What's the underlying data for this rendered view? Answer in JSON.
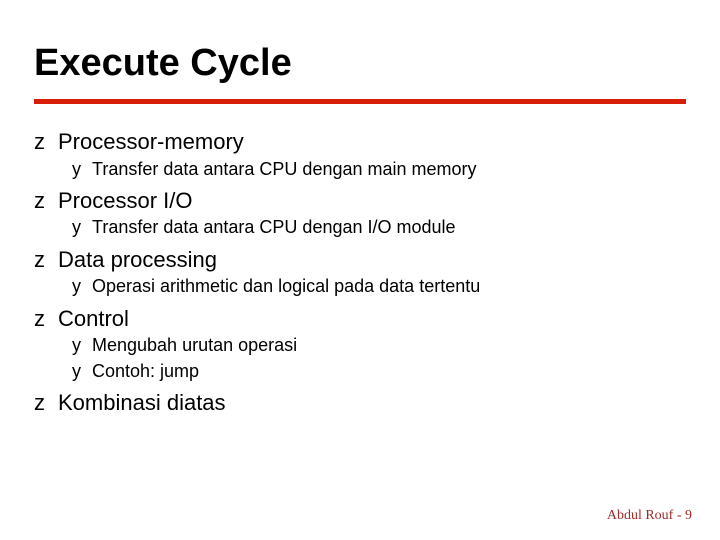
{
  "title": "Execute Cycle",
  "bullets": {
    "b1": "Processor-memory",
    "b1a": "Transfer data antara CPU dengan main memory",
    "b2": "Processor I/O",
    "b2a": "Transfer data antara CPU dengan I/O module",
    "b3": "Data processing",
    "b3a": "Operasi arithmetic dan logical pada data tertentu",
    "b4": "Control",
    "b4a": "Mengubah urutan operasi",
    "b4b": "Contoh: jump",
    "b5": "Kombinasi diatas"
  },
  "glyphs": {
    "z": "❚",
    "y": "❙"
  },
  "footer": "Abdul Rouf - 9"
}
